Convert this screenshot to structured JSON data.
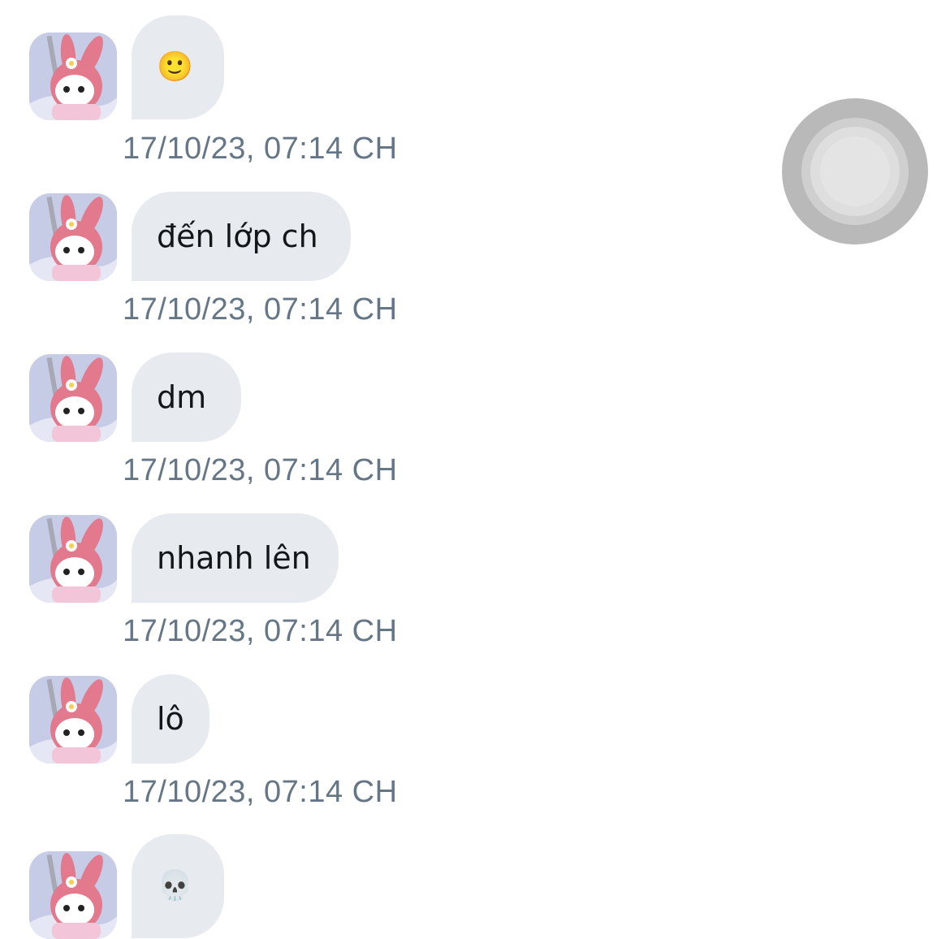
{
  "messages": [
    {
      "content": "🙂",
      "kind": "emoji",
      "timestamp": "17/10/23, 07:14 CH"
    },
    {
      "content": "đến lớp ch",
      "kind": "text",
      "timestamp": "17/10/23, 07:14 CH"
    },
    {
      "content": "dm",
      "kind": "text",
      "timestamp": "17/10/23, 07:14 CH"
    },
    {
      "content": "nhanh lên",
      "kind": "text",
      "timestamp": "17/10/23, 07:14 CH"
    },
    {
      "content": "lô",
      "kind": "text",
      "timestamp": "17/10/23, 07:14 CH"
    },
    {
      "content": "💀",
      "kind": "emoji",
      "timestamp": ""
    }
  ],
  "avatar_icon": "my-melody-avatar",
  "assistive_touch_icon": "assistive-touch-button",
  "colors": {
    "bubble": "#e7ebef",
    "text": "#14171a",
    "timestamp": "#657786",
    "background": "#ffffff"
  }
}
